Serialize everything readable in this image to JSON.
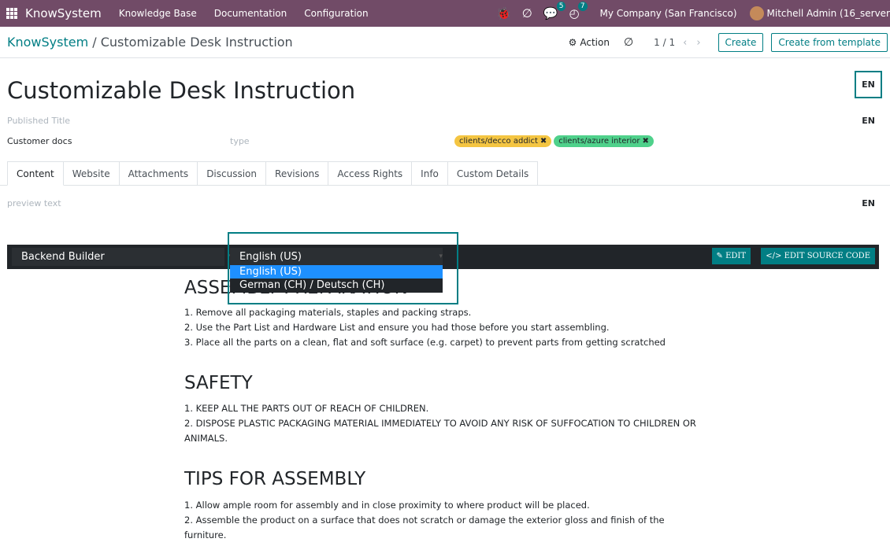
{
  "navbar": {
    "app_name": "KnowSystem",
    "menu": [
      "Knowledge Base",
      "Documentation",
      "Configuration"
    ],
    "messages_count": "5",
    "activities_count": "7",
    "company": "My Company (San Francisco)",
    "user": "Mitchell Admin (16_server"
  },
  "control": {
    "breadcrumb_root": "KnowSystem",
    "breadcrumb_sep": " / ",
    "breadcrumb_current": "Customizable Desk Instruction",
    "action_label": "Action",
    "pager": "1 / 1",
    "create_label": "Create",
    "create_template_label": "Create from template"
  },
  "form": {
    "title": "Customizable Desk Instruction",
    "lang": "EN",
    "published_title_placeholder": "Published Title",
    "customer_docs": "Customer docs",
    "type_placeholder": "type",
    "tags": [
      {
        "label": "clients/decco addict",
        "color": "#f4c542"
      },
      {
        "label": "clients/azure interior",
        "color": "#4fd18b"
      }
    ],
    "preview_placeholder": "preview text"
  },
  "tabs": [
    "Content",
    "Website",
    "Attachments",
    "Discussion",
    "Revisions",
    "Access Rights",
    "Info",
    "Custom Details"
  ],
  "toolbar": {
    "builder_label": "Backend Builder",
    "language_selected": "English (US)",
    "edit_label": "EDIT",
    "edit_source_label": "EDIT SOURCE CODE"
  },
  "dropdown": {
    "options": [
      "English (US)",
      "German (CH) / Deutsch (CH)"
    ]
  },
  "article": {
    "heading1": "ASSEMBLY PREPARATION",
    "list1": [
      " 1. Remove all packaging materials, staples and packing straps.",
      "2. Use the Part List and Hardware List and ensure you had those before you start assembling.",
      "3. Place all the parts on a clean, flat and soft surface (e.g. carpet) to prevent parts from getting scratched"
    ],
    "heading2": "SAFETY",
    "list2": [
      "1. KEEP ALL THE PARTS OUT OF REACH OF CHILDREN.",
      "2. DISPOSE PLASTIC PACKAGING MATERIAL IMMEDIATELY TO AVOID ANY RISK OF SUFFOCATION TO CHILDREN OR ANIMALS."
    ],
    "heading3": "TIPS FOR ASSEMBLY",
    "list3": [
      " 1. Allow ample room for assembly and in close proximity to where product will be placed.",
      "2. Assemble the product on a surface that does not scratch or damage the exterior gloss and finish of the furniture."
    ]
  }
}
